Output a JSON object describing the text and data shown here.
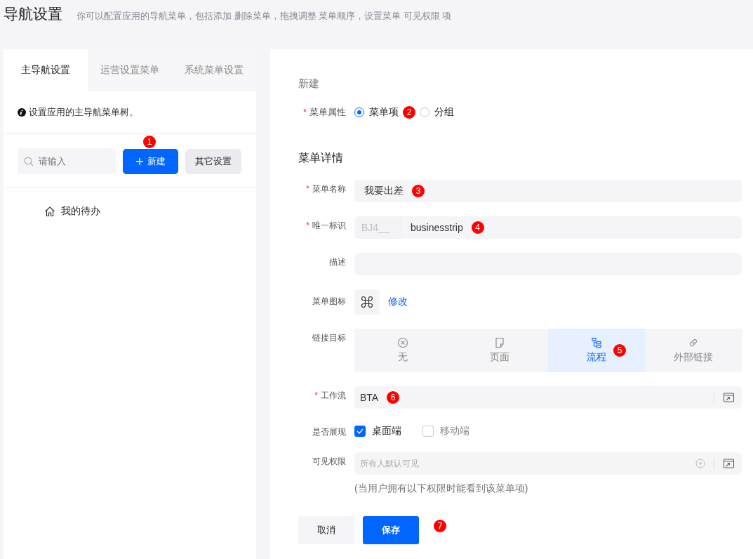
{
  "header": {
    "title": "导航设置",
    "description": "你可以配置应用的导航菜单，包括添加 删除菜单，拖拽调整 菜单顺序，设置菜单 可见权限 项"
  },
  "sidebar": {
    "tabs": [
      {
        "label": "主导航设置",
        "selected": true
      },
      {
        "label": "运营设置菜单",
        "selected": false
      },
      {
        "label": "系统菜单设置",
        "selected": false
      }
    ],
    "hint": "设置应用的主导航菜单树。",
    "search": {
      "placeholder": "请输入"
    },
    "new_button": {
      "label": "新建",
      "marker": "1"
    },
    "other_button": {
      "label": "其它设置"
    },
    "tree": [
      {
        "label": "我的待办"
      }
    ]
  },
  "form": {
    "title": "新建",
    "menu_type": {
      "label": "菜单属性",
      "required_mark": "*",
      "options": [
        {
          "label": "菜单项",
          "selected": true,
          "marker": "2"
        },
        {
          "label": "分组",
          "selected": false
        }
      ]
    },
    "details_title": "菜单详情",
    "fields": [
      {
        "kind": "text",
        "label": "菜单名称",
        "required_mark": "*",
        "value": "我要出差",
        "marker": "3"
      },
      {
        "kind": "id",
        "label": "唯一标识",
        "required_mark": "*",
        "prefix": "BJ4__",
        "value": "businesstrip",
        "marker": "4"
      },
      {
        "kind": "text",
        "label": "描述"
      },
      {
        "kind": "icon",
        "label": "菜单图标",
        "link": "修改"
      },
      {
        "kind": "segmented",
        "label": "链接目标",
        "options": [
          {
            "label": "无",
            "selected": false
          },
          {
            "label": "页面",
            "selected": false
          },
          {
            "label": "流程",
            "selected": true,
            "marker": "5"
          },
          {
            "label": "外部链接",
            "selected": false
          }
        ]
      },
      {
        "kind": "picker",
        "label": "工作流",
        "required_mark": "*",
        "value": "BTA",
        "marker": "6"
      },
      {
        "kind": "checks",
        "label": "是否展现",
        "options": [
          {
            "label": "桌面端",
            "checked": true
          },
          {
            "label": "移动端",
            "checked": false
          }
        ]
      },
      {
        "kind": "permission",
        "label": "可见权限",
        "placeholder": "所有人默认可见",
        "note": "(当用户拥有以下权限时能看到该菜单项)"
      }
    ],
    "cancel_button": "取消",
    "save_button": {
      "label": "保存",
      "marker": "7"
    }
  }
}
